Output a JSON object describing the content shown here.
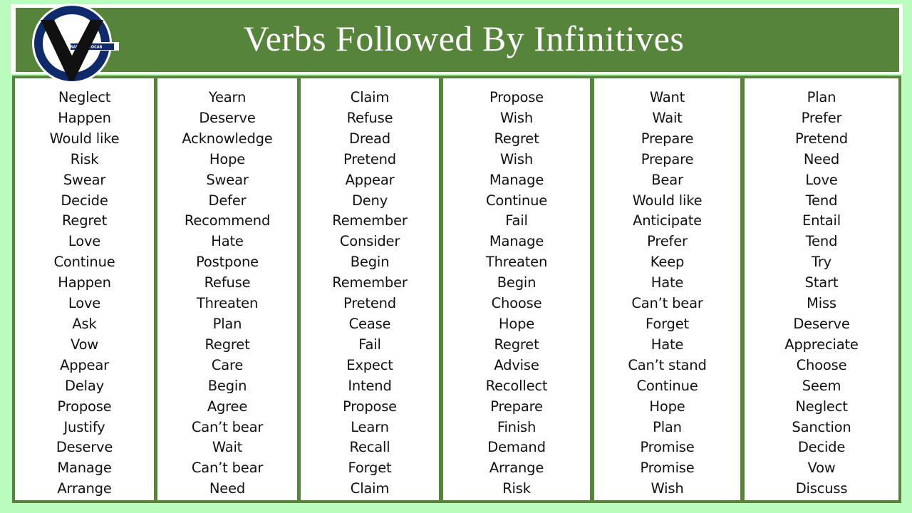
{
  "header": {
    "title": "Verbs Followed By Infinitives",
    "logo_text": "GRAMMARVOCAB",
    "background_color": "#56843b",
    "title_color": "#ffffff"
  },
  "page": {
    "background_color": "#b9fcbd",
    "border_color": "#56843b"
  },
  "columns": [
    {
      "words": [
        "Neglect",
        "Happen",
        "Would like",
        "Risk",
        "Swear",
        "Decide",
        "Regret",
        "Love",
        "Continue",
        "Happen",
        "Love",
        "Ask",
        "Vow",
        "Appear",
        "Delay",
        "Propose",
        "Justify",
        "Deserve",
        "Manage",
        "Arrange"
      ]
    },
    {
      "words": [
        "Yearn",
        "Deserve",
        "Acknowledge",
        "Hope",
        "Swear",
        "Defer",
        "Recommend",
        "Hate",
        "Postpone",
        "Refuse",
        "Threaten",
        "Plan",
        "Regret",
        "Care",
        "Begin",
        "Agree",
        "Can’t bear",
        "Wait",
        "Can’t bear",
        "Need"
      ]
    },
    {
      "words": [
        "Claim",
        "Refuse",
        "Dread",
        "Pretend",
        "Appear",
        "Deny",
        "Remember",
        "Consider",
        "Begin",
        "Remember",
        "Pretend",
        "Cease",
        "Fail",
        "Expect",
        "Intend",
        "Propose",
        "Learn",
        "Recall",
        "Forget",
        "Claim"
      ]
    },
    {
      "words": [
        "Propose",
        "Wish",
        "Regret",
        "Wish",
        "Manage",
        "Continue",
        "Fail",
        "Manage",
        "Threaten",
        "Begin",
        "Choose",
        "Hope",
        "Regret",
        "Advise",
        "Recollect",
        "Prepare",
        "Finish",
        "Demand",
        "Arrange",
        "Risk"
      ]
    },
    {
      "words": [
        "Want",
        "Wait",
        "Prepare",
        "Prepare",
        "Bear",
        "Would like",
        "Anticipate",
        "Prefer",
        "Keep",
        "Hate",
        "Can’t bear",
        "Forget",
        "Hate",
        "Can’t stand",
        "Continue",
        "Hope",
        "Plan",
        "Promise",
        "Promise",
        "Wish"
      ]
    },
    {
      "words": [
        "Plan",
        "Prefer",
        "Pretend",
        "Need",
        "Love",
        "Tend",
        "Entail",
        "Tend",
        "Try",
        "Start",
        "Miss",
        "Deserve",
        "Appreciate",
        "Choose",
        "Seem",
        "Neglect",
        "Sanction",
        "Decide",
        "Vow",
        "Discuss"
      ]
    }
  ]
}
